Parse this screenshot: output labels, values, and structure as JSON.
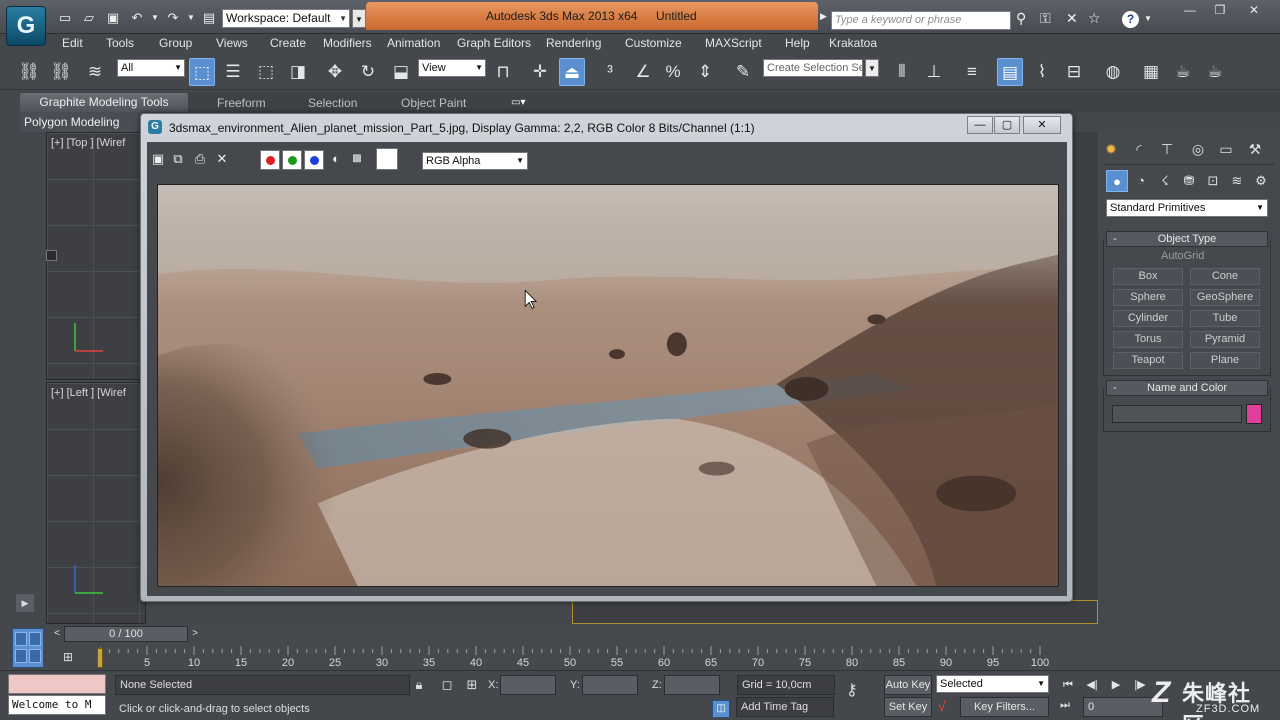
{
  "titlebar": {
    "workspace": "Workspace: Default",
    "app_title": "Autodesk 3ds Max  2013 x64",
    "doc_title": "Untitled",
    "search_placeholder": "Type a keyword or phrase"
  },
  "menu": [
    "Edit",
    "Tools",
    "Group",
    "Views",
    "Create",
    "Modifiers",
    "Animation",
    "Graph Editors",
    "Rendering",
    "Customize",
    "MAXScript",
    "Help",
    "Krakatoa"
  ],
  "toolbar": {
    "selection_filter": "All",
    "ref_coord": "View",
    "selection_set_placeholder": "Create Selection Se"
  },
  "ribbon": {
    "tabs": [
      "Graphite Modeling Tools",
      "Freeform",
      "Selection",
      "Object Paint"
    ],
    "sub_tab": "Polygon Modeling"
  },
  "viewports": {
    "top_label": "[+] [Top ] [Wiref",
    "left_label": "[+] [Left ] [Wiref"
  },
  "frame_window": {
    "title": "3dsmax_environment_Alien_planet_mission_Part_5.jpg, Display Gamma: 2,2, RGB Color 8 Bits/Channel (1:1)",
    "channel": "RGB Alpha",
    "channel_colors": {
      "red": "#e02020",
      "green": "#1a9a1a",
      "blue": "#1f3fd6"
    }
  },
  "command_panel": {
    "category": "Standard Primitives",
    "object_type_header": "Object Type",
    "autogrid_label": "AutoGrid",
    "object_buttons": [
      "Box",
      "Cone",
      "Sphere",
      "GeoSphere",
      "Cylinder",
      "Tube",
      "Torus",
      "Pyramid",
      "Teapot",
      "Plane"
    ],
    "name_color_header": "Name and Color",
    "object_color": "#e0409a"
  },
  "timeline": {
    "slider_value": "0 / 100",
    "ticks": [
      "5",
      "10",
      "15",
      "20",
      "25",
      "30",
      "35",
      "40",
      "45",
      "50",
      "55",
      "60",
      "65",
      "70",
      "75",
      "80",
      "85",
      "90",
      "95",
      "100"
    ]
  },
  "status": {
    "listener_text": "Welcome to M",
    "selection": "None Selected",
    "prompt": "Click or click-and-drag to select objects",
    "x_label": "X:",
    "y_label": "Y:",
    "z_label": "Z:",
    "grid": "Grid = 10,0cm",
    "auto_key": "Auto Key",
    "set_key": "Set Key",
    "key_mode": "Selected",
    "key_filters": "Key Filters...",
    "add_time_tag": "Add Time Tag",
    "current_frame": "0"
  },
  "watermark": {
    "text": "朱峰社区",
    "site": "ZF3D.COM"
  }
}
